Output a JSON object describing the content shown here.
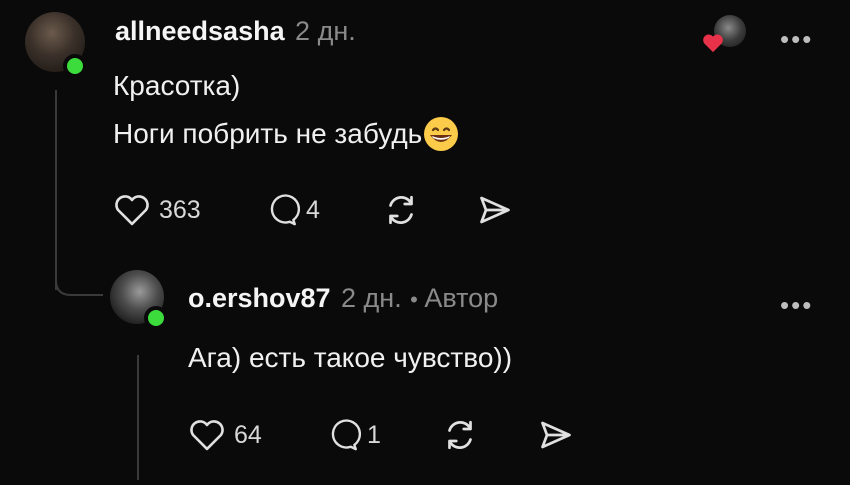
{
  "comment": {
    "username": "allneedsasha",
    "time": "2 дн.",
    "lines": [
      "Красотка)",
      "Ноги побрить не забудь"
    ],
    "emoji": "grinning-face",
    "likes": "363",
    "replies": "4",
    "more": "•••",
    "liked_by_author": true
  },
  "reply": {
    "username": "o.ershov87",
    "time": "2 дн.",
    "separator": "•",
    "badge": "Автор",
    "text": "Ага) есть такое чувство))",
    "likes": "64",
    "replies": "1",
    "more": "•••"
  },
  "colors": {
    "background": "#0a0a0a",
    "online": "#3ddc3d",
    "heart": "#e8324a",
    "muted": "#8a8a8a"
  }
}
